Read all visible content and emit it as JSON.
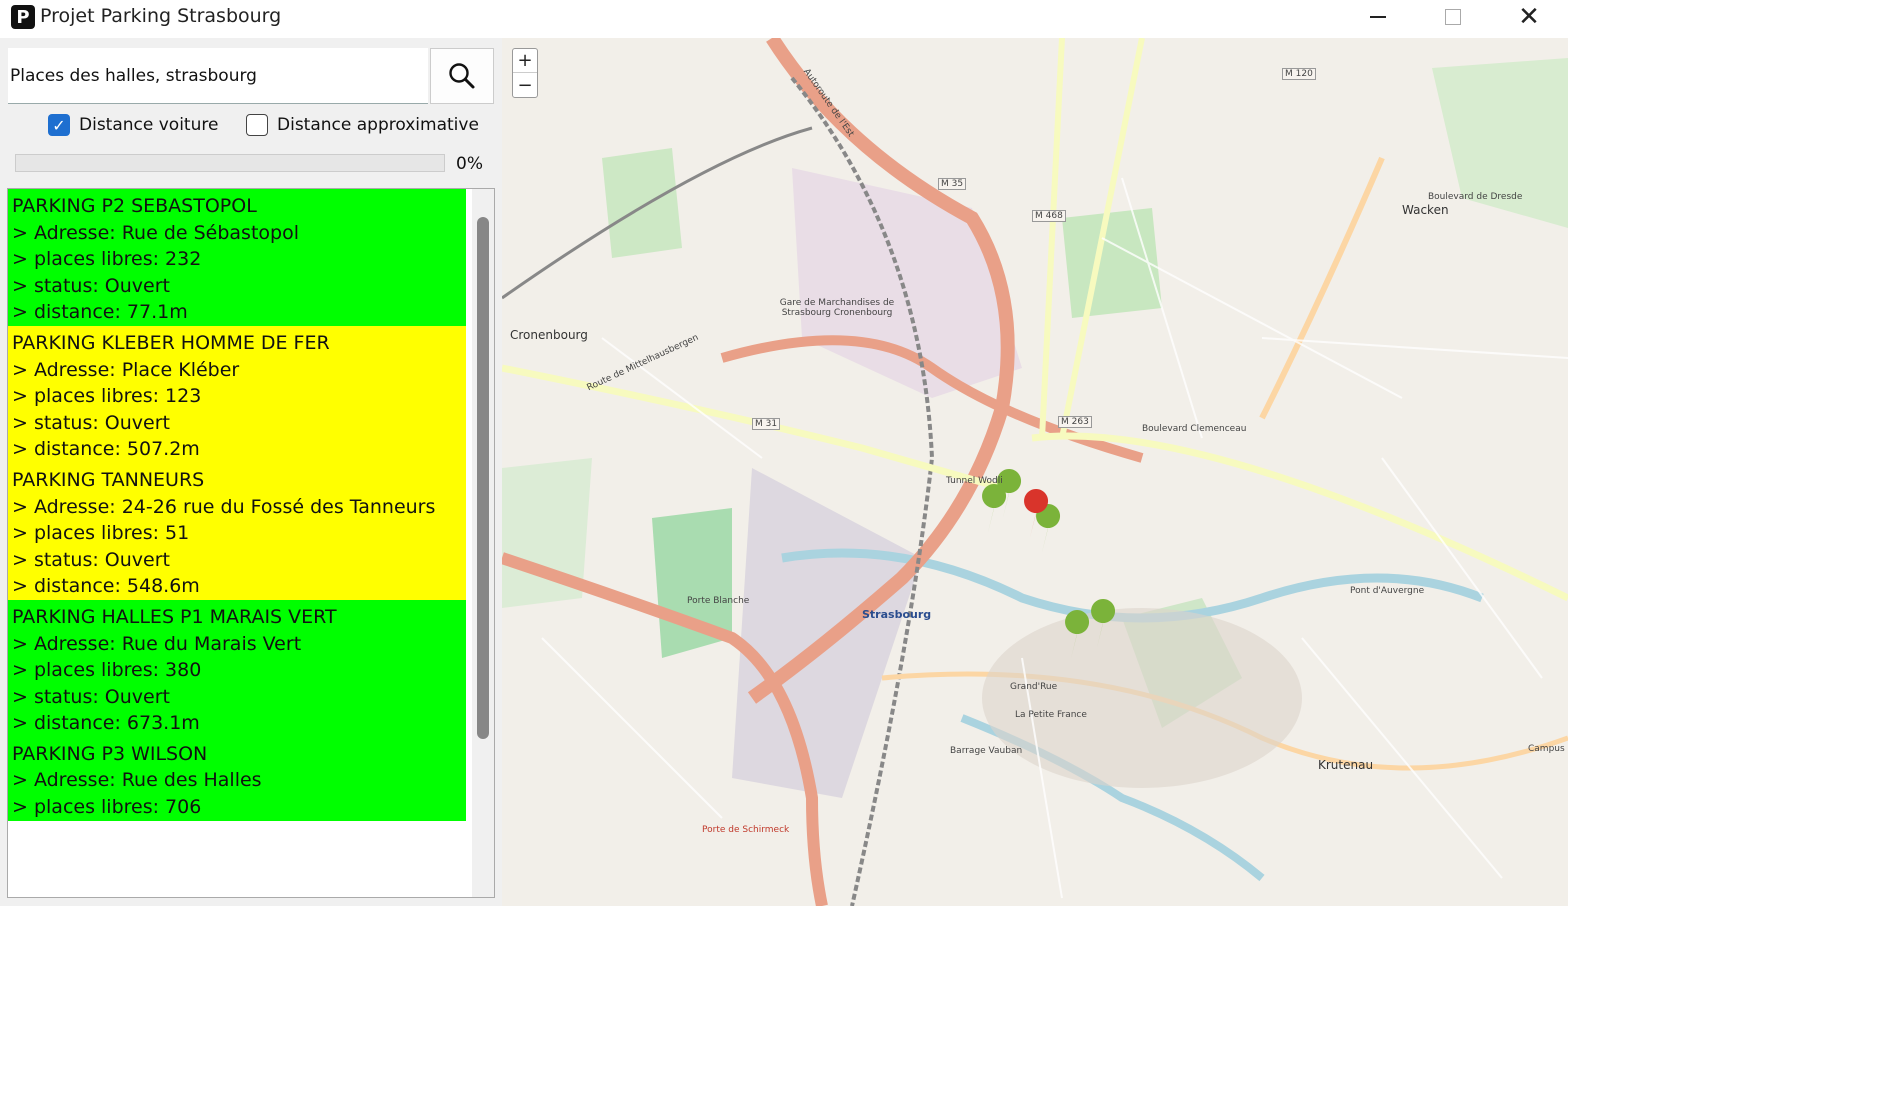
{
  "window": {
    "title": "Projet Parking Strasbourg",
    "icon_letter": "P"
  },
  "search": {
    "value": "Places des halles, strasbourg",
    "button_icon": "search-icon"
  },
  "options": {
    "driving_distance": {
      "label": "Distance voiture",
      "checked": true
    },
    "approx_distance": {
      "label": "Distance approximative",
      "checked": false
    }
  },
  "progress": {
    "value": 0,
    "label": "0%"
  },
  "parkings": [
    {
      "name": "PARKING P2 SEBASTOPOL",
      "address": "> Adresse: Rue de Sébastopol",
      "free": "> places libres: 232",
      "status": "> status: Ouvert",
      "distance": "> distance: 77.1m",
      "color": "#00ff00"
    },
    {
      "name": "PARKING KLEBER HOMME DE FER",
      "address": "> Adresse: Place Kléber",
      "free": "> places libres: 123",
      "status": "> status: Ouvert",
      "distance": "> distance: 507.2m",
      "color": "#ffff00"
    },
    {
      "name": "PARKING TANNEURS",
      "address": "> Adresse: 24-26 rue du Fossé des Tanneurs",
      "free": "> places libres: 51",
      "status": "> status: Ouvert",
      "distance": "> distance: 548.6m",
      "color": "#ffff00"
    },
    {
      "name": "PARKING HALLES P1 MARAIS VERT",
      "address": "> Adresse: Rue du Marais Vert",
      "free": "> places libres: 380",
      "status": "> status: Ouvert",
      "distance": "> distance: 673.1m",
      "color": "#00ff00"
    },
    {
      "name": "PARKING P3 WILSON",
      "address": "> Adresse: Rue des Halles",
      "free": "> places libres: 706",
      "status": "",
      "distance": "",
      "color": "#00ff00"
    }
  ],
  "map": {
    "zoom_in": "+",
    "zoom_out": "−",
    "labels": [
      "Strasbourg",
      "Cronenbourg",
      "Wacken",
      "Krutenau",
      "La Petite France",
      "Gare de Marchandises de Strasbourg Cronenbourg",
      "Porte Blanche",
      "Pont d'Auvergne",
      "Barrage Vauban",
      "Porte de Schirmeck",
      "M 35",
      "M 31",
      "M 263",
      "M 468",
      "M 120",
      "Boulevard Clemenceau",
      "Route de Mittelhausbergen",
      "Boulevard de Dresde",
      "Autoroute de l'Est",
      "Grand'Rue",
      "Tunnel Wodli",
      "Campus Centre"
    ]
  }
}
